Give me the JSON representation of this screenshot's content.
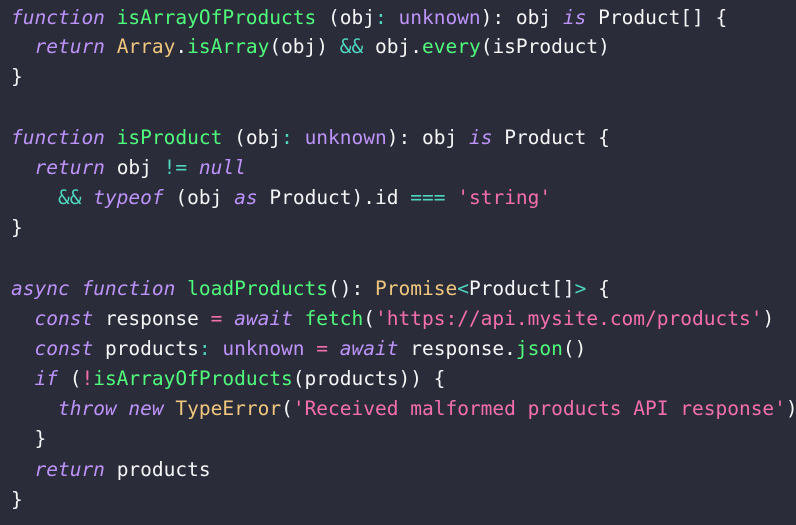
{
  "editor": {
    "language": "TypeScript",
    "background_color": "#2a2c3a",
    "theme_colors": {
      "keyword": "#bd93f9",
      "function": "#50fa7b",
      "type": "#f1c77e",
      "string": "#f56fae",
      "operator": "#4fd6c0",
      "assign": "#f56fae",
      "plain": "#f5f5f6"
    },
    "full_text": "function isArrayOfProducts (obj: unknown): obj is Product[] {\n  return Array.isArray(obj) && obj.every(isProduct)\n}\n\nfunction isProduct (obj: unknown): obj is Product {\n  return obj != null\n    && typeof (obj as Product).id === 'string'\n}\n\nasync function loadProducts(): Promise<Product[]> {\n  const response = await fetch('https://api.mysite.com/products')\n  const products: unknown = await response.json()\n  if (!isArrayOfProducts(products)) {\n    throw new TypeError('Received malformed products API response')\n  }\n  return products\n}",
    "lines": [
      {
        "index": 1,
        "text": "function isArrayOfProducts (obj: unknown): obj is Product[] {",
        "tokens": [
          {
            "t": "function",
            "c": "keyword"
          },
          {
            "t": " ",
            "c": "plain"
          },
          {
            "t": "isArrayOfProducts",
            "c": "func"
          },
          {
            "t": " (",
            "c": "plain"
          },
          {
            "t": "obj",
            "c": "plain"
          },
          {
            "t": ":",
            "c": "operator"
          },
          {
            "t": " ",
            "c": "plain"
          },
          {
            "t": "unknown",
            "c": "builtin"
          },
          {
            "t": "):",
            "c": "plain"
          },
          {
            "t": " ",
            "c": "plain"
          },
          {
            "t": "obj",
            "c": "plain"
          },
          {
            "t": " ",
            "c": "plain"
          },
          {
            "t": "is",
            "c": "keyword"
          },
          {
            "t": " ",
            "c": "plain"
          },
          {
            "t": "Product[] {",
            "c": "plain"
          }
        ]
      },
      {
        "index": 2,
        "text": "  return Array.isArray(obj) && obj.every(isProduct)",
        "tokens": [
          {
            "t": "  ",
            "c": "plain"
          },
          {
            "t": "return",
            "c": "keyword"
          },
          {
            "t": " ",
            "c": "plain"
          },
          {
            "t": "Array",
            "c": "type"
          },
          {
            "t": ".",
            "c": "plain"
          },
          {
            "t": "isArray",
            "c": "func"
          },
          {
            "t": "(obj)",
            "c": "plain"
          },
          {
            "t": " ",
            "c": "plain"
          },
          {
            "t": "&&",
            "c": "operator"
          },
          {
            "t": " ",
            "c": "plain"
          },
          {
            "t": "obj",
            "c": "plain"
          },
          {
            "t": ".",
            "c": "plain"
          },
          {
            "t": "every",
            "c": "func"
          },
          {
            "t": "(isProduct)",
            "c": "plain"
          }
        ]
      },
      {
        "index": 3,
        "text": "}",
        "tokens": [
          {
            "t": "}",
            "c": "plain"
          }
        ]
      },
      {
        "index": 4,
        "text": "",
        "tokens": []
      },
      {
        "index": 5,
        "text": "function isProduct (obj: unknown): obj is Product {",
        "tokens": [
          {
            "t": "function",
            "c": "keyword"
          },
          {
            "t": " ",
            "c": "plain"
          },
          {
            "t": "isProduct",
            "c": "func"
          },
          {
            "t": " (",
            "c": "plain"
          },
          {
            "t": "obj",
            "c": "plain"
          },
          {
            "t": ":",
            "c": "operator"
          },
          {
            "t": " ",
            "c": "plain"
          },
          {
            "t": "unknown",
            "c": "builtin"
          },
          {
            "t": "):",
            "c": "plain"
          },
          {
            "t": " ",
            "c": "plain"
          },
          {
            "t": "obj",
            "c": "plain"
          },
          {
            "t": " ",
            "c": "plain"
          },
          {
            "t": "is",
            "c": "keyword"
          },
          {
            "t": " ",
            "c": "plain"
          },
          {
            "t": "Product {",
            "c": "plain"
          }
        ]
      },
      {
        "index": 6,
        "text": "  return obj != null",
        "tokens": [
          {
            "t": "  ",
            "c": "plain"
          },
          {
            "t": "return",
            "c": "keyword"
          },
          {
            "t": " ",
            "c": "plain"
          },
          {
            "t": "obj",
            "c": "plain"
          },
          {
            "t": " ",
            "c": "plain"
          },
          {
            "t": "!=",
            "c": "operator"
          },
          {
            "t": " ",
            "c": "plain"
          },
          {
            "t": "null",
            "c": "keyword"
          }
        ]
      },
      {
        "index": 7,
        "text": "    && typeof (obj as Product).id === 'string'",
        "tokens": [
          {
            "t": "    ",
            "c": "plain"
          },
          {
            "t": "&&",
            "c": "operator"
          },
          {
            "t": " ",
            "c": "plain"
          },
          {
            "t": "typeof",
            "c": "keyword"
          },
          {
            "t": " ",
            "c": "plain"
          },
          {
            "t": "(obj",
            "c": "plain"
          },
          {
            "t": " ",
            "c": "plain"
          },
          {
            "t": "as",
            "c": "keyword"
          },
          {
            "t": " ",
            "c": "plain"
          },
          {
            "t": "Product).id",
            "c": "plain"
          },
          {
            "t": " ",
            "c": "plain"
          },
          {
            "t": "===",
            "c": "operator"
          },
          {
            "t": " ",
            "c": "plain"
          },
          {
            "t": "'string'",
            "c": "string"
          }
        ]
      },
      {
        "index": 8,
        "text": "}",
        "tokens": [
          {
            "t": "}",
            "c": "plain"
          }
        ]
      },
      {
        "index": 9,
        "text": "",
        "tokens": []
      },
      {
        "index": 10,
        "text": "async function loadProducts(): Promise<Product[]> {",
        "tokens": [
          {
            "t": "async",
            "c": "keyword"
          },
          {
            "t": " ",
            "c": "plain"
          },
          {
            "t": "function",
            "c": "keyword"
          },
          {
            "t": " ",
            "c": "plain"
          },
          {
            "t": "loadProducts",
            "c": "func"
          },
          {
            "t": "():",
            "c": "plain"
          },
          {
            "t": " ",
            "c": "plain"
          },
          {
            "t": "Promise",
            "c": "type"
          },
          {
            "t": "<",
            "c": "operator"
          },
          {
            "t": "Product[]",
            "c": "plain"
          },
          {
            "t": ">",
            "c": "operator"
          },
          {
            "t": " {",
            "c": "plain"
          }
        ]
      },
      {
        "index": 11,
        "text": "  const response = await fetch('https://api.mysite.com/products')",
        "tokens": [
          {
            "t": "  ",
            "c": "plain"
          },
          {
            "t": "const",
            "c": "keyword"
          },
          {
            "t": " ",
            "c": "plain"
          },
          {
            "t": "response",
            "c": "plain"
          },
          {
            "t": " ",
            "c": "plain"
          },
          {
            "t": "=",
            "c": "assign"
          },
          {
            "t": " ",
            "c": "plain"
          },
          {
            "t": "await",
            "c": "keyword"
          },
          {
            "t": " ",
            "c": "plain"
          },
          {
            "t": "fetch",
            "c": "func"
          },
          {
            "t": "(",
            "c": "plain"
          },
          {
            "t": "'https://api.mysite.com/products'",
            "c": "string"
          },
          {
            "t": ")",
            "c": "plain"
          }
        ]
      },
      {
        "index": 12,
        "text": "  const products: unknown = await response.json()",
        "tokens": [
          {
            "t": "  ",
            "c": "plain"
          },
          {
            "t": "const",
            "c": "keyword"
          },
          {
            "t": " ",
            "c": "plain"
          },
          {
            "t": "products",
            "c": "plain"
          },
          {
            "t": ":",
            "c": "operator"
          },
          {
            "t": " ",
            "c": "plain"
          },
          {
            "t": "unknown",
            "c": "builtin"
          },
          {
            "t": " ",
            "c": "plain"
          },
          {
            "t": "=",
            "c": "assign"
          },
          {
            "t": " ",
            "c": "plain"
          },
          {
            "t": "await",
            "c": "keyword"
          },
          {
            "t": " ",
            "c": "plain"
          },
          {
            "t": "response",
            "c": "plain"
          },
          {
            "t": ".",
            "c": "plain"
          },
          {
            "t": "json",
            "c": "func"
          },
          {
            "t": "()",
            "c": "plain"
          }
        ]
      },
      {
        "index": 13,
        "text": "  if (!isArrayOfProducts(products)) {",
        "tokens": [
          {
            "t": "  ",
            "c": "plain"
          },
          {
            "t": "if",
            "c": "keyword"
          },
          {
            "t": " (",
            "c": "plain"
          },
          {
            "t": "!",
            "c": "assign"
          },
          {
            "t": "isArrayOfProducts",
            "c": "func"
          },
          {
            "t": "(products)) {",
            "c": "plain"
          }
        ]
      },
      {
        "index": 14,
        "text": "    throw new TypeError('Received malformed products API response')",
        "tokens": [
          {
            "t": "    ",
            "c": "plain"
          },
          {
            "t": "throw",
            "c": "keyword"
          },
          {
            "t": " ",
            "c": "plain"
          },
          {
            "t": "new",
            "c": "keyword"
          },
          {
            "t": " ",
            "c": "plain"
          },
          {
            "t": "TypeError",
            "c": "type"
          },
          {
            "t": "(",
            "c": "plain"
          },
          {
            "t": "'Received malformed products API response'",
            "c": "string"
          },
          {
            "t": ")",
            "c": "plain"
          }
        ]
      },
      {
        "index": 15,
        "text": "  }",
        "tokens": [
          {
            "t": "  }",
            "c": "plain"
          }
        ]
      },
      {
        "index": 16,
        "text": "  return products",
        "tokens": [
          {
            "t": "  ",
            "c": "plain"
          },
          {
            "t": "return",
            "c": "keyword"
          },
          {
            "t": " ",
            "c": "plain"
          },
          {
            "t": "products",
            "c": "plain"
          }
        ]
      },
      {
        "index": 17,
        "text": "}",
        "tokens": [
          {
            "t": "}",
            "c": "plain"
          }
        ]
      }
    ]
  }
}
